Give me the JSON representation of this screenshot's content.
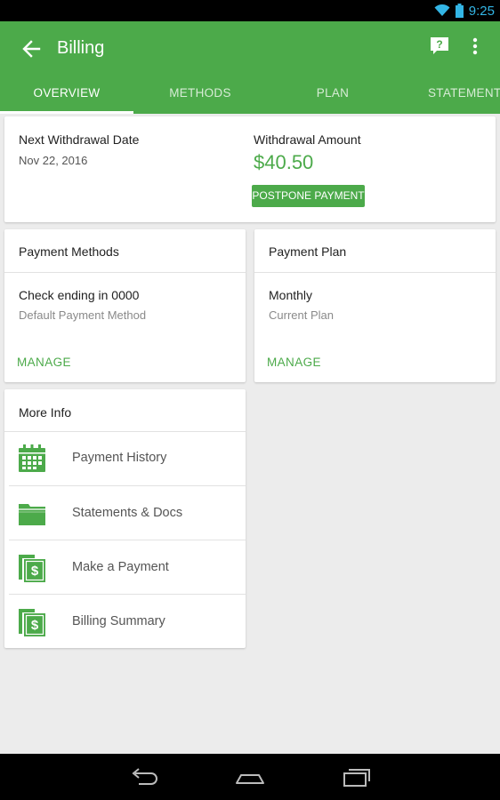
{
  "status_bar": {
    "time": "9:25",
    "icons": [
      "wifi-icon",
      "battery-icon"
    ]
  },
  "app_bar": {
    "title": "Billing",
    "back_icon": "arrow-left-icon",
    "actions": [
      "help-chat-icon",
      "more-vert-icon"
    ]
  },
  "tabs": [
    {
      "label": "OVERVIEW",
      "active": true
    },
    {
      "label": "METHODS",
      "active": false
    },
    {
      "label": "PLAN",
      "active": false
    },
    {
      "label": "STATEMENTS",
      "active": false
    }
  ],
  "withdrawal": {
    "date_label": "Next Withdrawal Date",
    "date_value": "Nov 22, 2016",
    "amount_label": "Withdrawal Amount",
    "amount_value": "$40.50",
    "postpone_label": "POSTPONE PAYMENT"
  },
  "payment_methods": {
    "title": "Payment Methods",
    "primary": "Check ending in 0000",
    "secondary": "Default Payment Method",
    "action": "MANAGE"
  },
  "payment_plan": {
    "title": "Payment Plan",
    "primary": "Monthly",
    "secondary": "Current Plan",
    "action": "MANAGE"
  },
  "more_info": {
    "title": "More Info",
    "items": [
      {
        "label": "Payment History",
        "icon": "calendar-icon"
      },
      {
        "label": "Statements & Docs",
        "icon": "folder-icon"
      },
      {
        "label": "Make a Payment",
        "icon": "dollar-document-icon"
      },
      {
        "label": "Billing Summary",
        "icon": "dollar-document-icon"
      }
    ]
  },
  "nav_bar": {
    "buttons": [
      "back-nav-icon",
      "home-nav-icon",
      "recents-nav-icon"
    ]
  },
  "colors": {
    "brand_green": "#4caa4a",
    "status_blue": "#33b5e5",
    "background": "#ececec"
  }
}
